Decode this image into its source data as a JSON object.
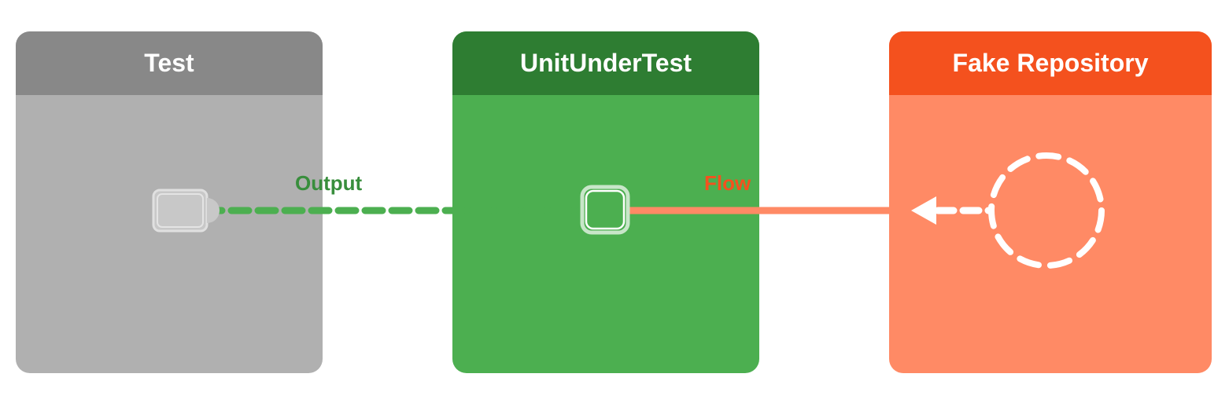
{
  "boxes": {
    "test": {
      "title": "Test",
      "header_bg": "#888888",
      "body_bg": "#b0b0b0"
    },
    "unit": {
      "title": "UnitUnderTest",
      "header_bg": "#2e7d32",
      "body_bg": "#4caf50"
    },
    "fake": {
      "title": "Fake Repository",
      "header_bg": "#f4511e",
      "body_bg": "#ff8a65"
    }
  },
  "labels": {
    "output": "Output",
    "flow": "Flow"
  },
  "colors": {
    "green_connector": "#4caf50",
    "orange_connector": "#ff8a65",
    "white": "#ffffff"
  }
}
